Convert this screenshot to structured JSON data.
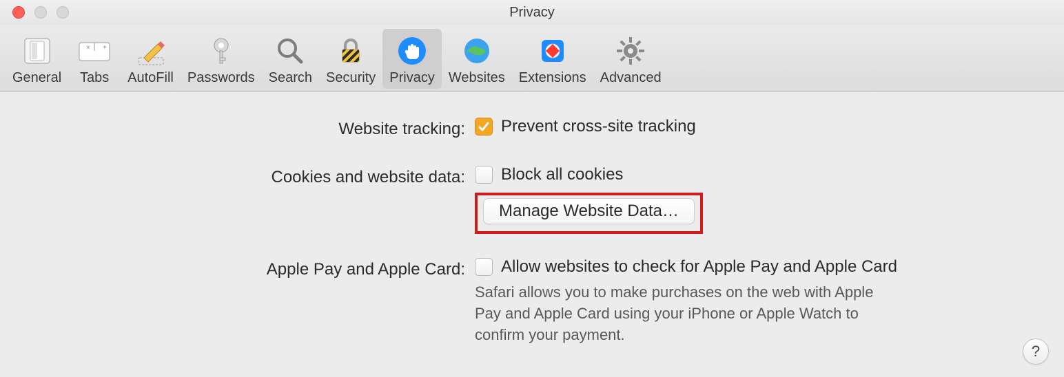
{
  "window": {
    "title": "Privacy"
  },
  "toolbar": {
    "items": [
      {
        "label": "General",
        "icon": "switch-icon",
        "active": false
      },
      {
        "label": "Tabs",
        "icon": "tabs-icon",
        "active": false
      },
      {
        "label": "AutoFill",
        "icon": "pencil-icon",
        "active": false
      },
      {
        "label": "Passwords",
        "icon": "key-icon",
        "active": false
      },
      {
        "label": "Search",
        "icon": "magnifier-icon",
        "active": false
      },
      {
        "label": "Security",
        "icon": "lock-icon",
        "active": false
      },
      {
        "label": "Privacy",
        "icon": "hand-icon",
        "active": true
      },
      {
        "label": "Websites",
        "icon": "globe-icon",
        "active": false
      },
      {
        "label": "Extensions",
        "icon": "puzzle-icon",
        "active": false
      },
      {
        "label": "Advanced",
        "icon": "gear-icon",
        "active": false
      }
    ]
  },
  "tracking": {
    "section_label": "Website tracking:",
    "prevent_label": "Prevent cross-site tracking",
    "prevent_checked": true
  },
  "cookies": {
    "section_label": "Cookies and website data:",
    "block_label": "Block all cookies",
    "block_checked": false,
    "manage_button": "Manage Website Data…"
  },
  "applepay": {
    "section_label": "Apple Pay and Apple Card:",
    "allow_label": "Allow websites to check for Apple Pay and Apple Card",
    "allow_checked": false,
    "help_text": "Safari allows you to make purchases on the web with Apple Pay and Apple Card using your iPhone or Apple Watch to confirm your payment."
  },
  "help_button": "?"
}
